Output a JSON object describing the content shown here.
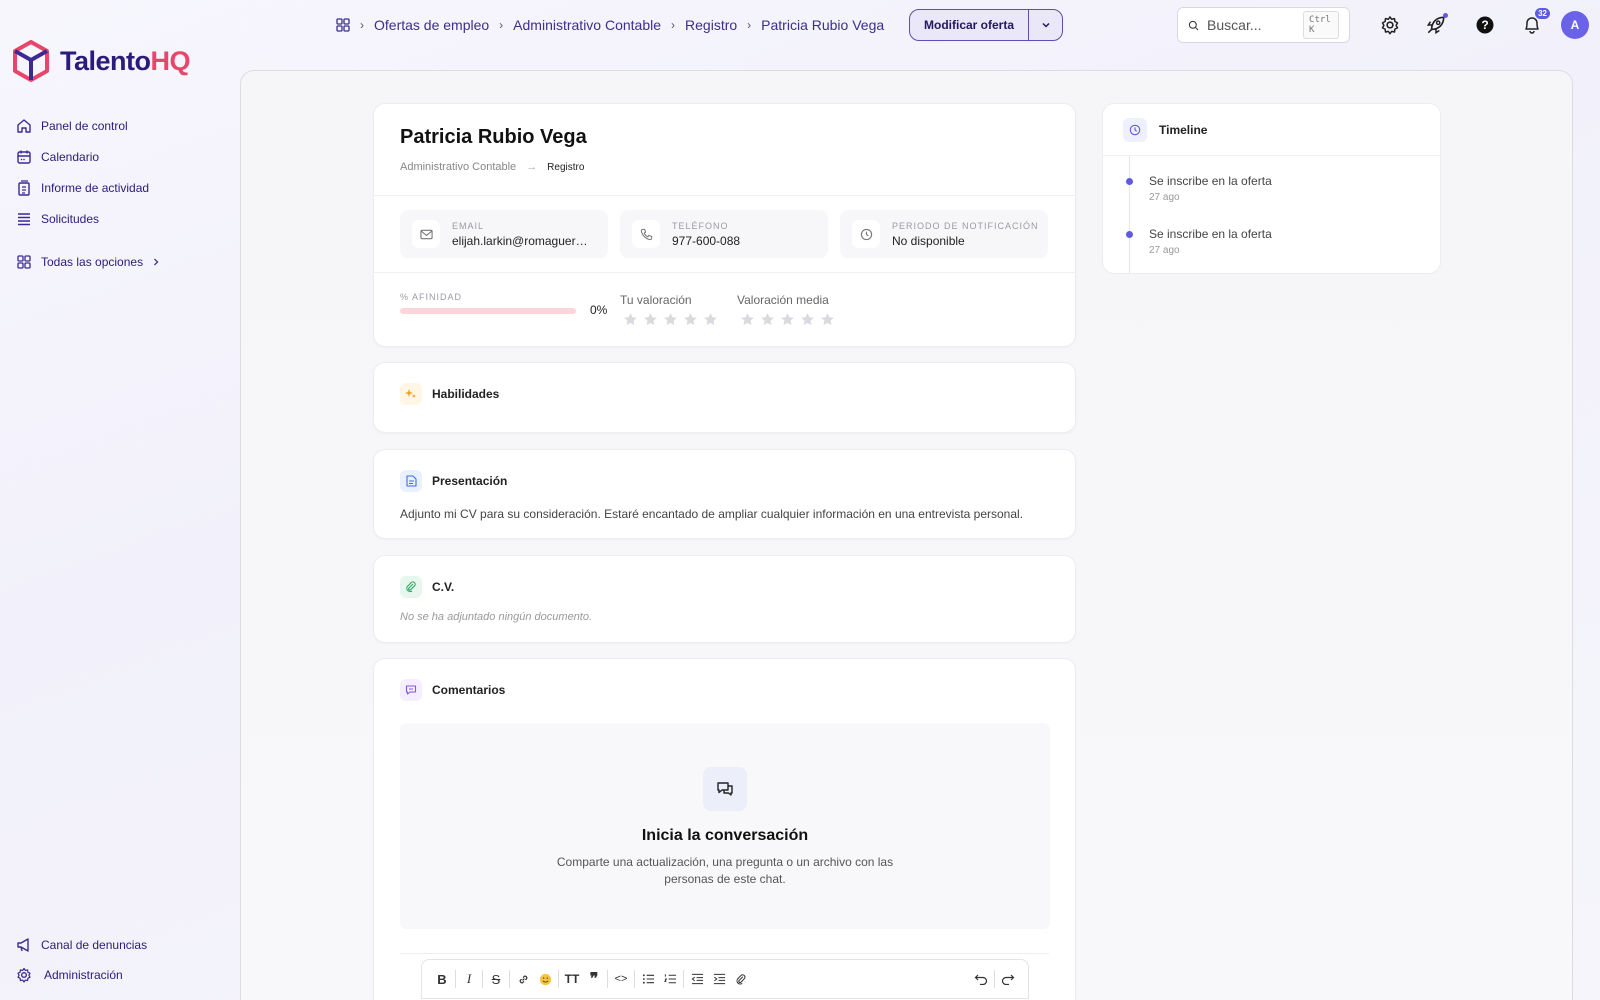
{
  "brand": {
    "name_part1": "Talento",
    "name_part2": "HQ",
    "accent": "#e8456b",
    "primary": "#2b1b7c"
  },
  "sidebar": {
    "items": [
      {
        "label": "Panel de control",
        "icon": "home-icon"
      },
      {
        "label": "Calendario",
        "icon": "calendar-icon"
      },
      {
        "label": "Informe de actividad",
        "icon": "report-icon"
      },
      {
        "label": "Solicitudes",
        "icon": "list-icon"
      }
    ],
    "all_options": "Todas las opciones",
    "bottom": [
      {
        "label": "Canal de denuncias",
        "icon": "megaphone-icon"
      },
      {
        "label": "Administración",
        "icon": "gear-icon"
      }
    ]
  },
  "topbar": {
    "breadcrumb": [
      "Ofertas de empleo",
      "Administrativo Contable",
      "Registro",
      "Patricia Rubio Vega"
    ],
    "action_button": "Modificar oferta",
    "search": {
      "placeholder": "Buscar...",
      "shortcut": "Ctrl K"
    },
    "notifications_count": "32",
    "avatar_initial": "A"
  },
  "candidate": {
    "name": "Patricia Rubio Vega",
    "path": [
      "Administrativo Contable",
      "Registro"
    ],
    "email": {
      "label": "EMAIL",
      "value": "elijah.larkin@romaguera.com"
    },
    "phone": {
      "label": "TELÉFONO",
      "value": "977-600-088"
    },
    "notice": {
      "label": "PERIODO DE NOTIFICACIÓN",
      "value": "No disponible"
    },
    "affinity": {
      "label": "% AFINIDAD",
      "value": "0%",
      "fraction": 0
    },
    "your_rating": {
      "label": "Tu valoración",
      "stars": 0,
      "max": 5
    },
    "avg_rating": {
      "label": "Valoración media",
      "stars": 0,
      "max": 5
    }
  },
  "sections": {
    "skills": {
      "title": "Habilidades"
    },
    "presentation": {
      "title": "Presentación",
      "text": "Adjunto mi CV para su consideración. Estaré encantado de ampliar cualquier información en una entrevista personal."
    },
    "cv": {
      "title": "C.V.",
      "empty": "No se ha adjuntado ningún documento."
    },
    "comments": {
      "title": "Comentarios",
      "empty_title": "Inicia la conversación",
      "empty_sub": "Comparte una actualización, una pregunta o un archivo con las personas de este chat."
    }
  },
  "timeline": {
    "title": "Timeline",
    "items": [
      {
        "title": "Se inscribe en la oferta",
        "time": "27 ago"
      },
      {
        "title": "Se inscribe en la oferta",
        "time": "27 ago"
      }
    ]
  }
}
